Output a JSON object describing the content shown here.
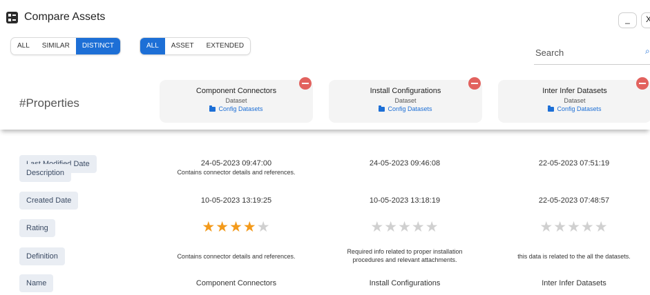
{
  "window": {
    "title": "Compare Assets",
    "minimize_label": "_",
    "close_label": "X"
  },
  "filters": {
    "similarity": [
      {
        "label": "All",
        "active": false
      },
      {
        "label": "Similar",
        "active": false
      },
      {
        "label": "Distinct",
        "active": true
      }
    ],
    "scope": [
      {
        "label": "All",
        "active": true
      },
      {
        "label": "Asset",
        "active": false
      },
      {
        "label": "Extended",
        "active": false
      }
    ]
  },
  "search": {
    "placeholder": "Search"
  },
  "header": {
    "properties_title": "#Properties"
  },
  "assets": [
    {
      "name": "Component Connectors",
      "type": "Dataset",
      "folder": "Config Datasets"
    },
    {
      "name": "Install Configurations",
      "type": "Dataset",
      "folder": "Config Datasets"
    },
    {
      "name": "Inter Infer Datasets",
      "type": "Dataset",
      "folder": "Config Datasets"
    }
  ],
  "rows": {
    "last_modified": {
      "label": "Last Modified Date",
      "values": [
        "24-05-2023 09:47:00",
        "24-05-2023 09:46:08",
        "22-05-2023 07:51:19"
      ]
    },
    "description": {
      "label": "Description",
      "values": [
        "Contains connector details and references.",
        "",
        ""
      ]
    },
    "created": {
      "label": "Created Date",
      "values": [
        "10-05-2023 13:19:25",
        "10-05-2023 13:18:19",
        "22-05-2023 07:48:57"
      ]
    },
    "rating": {
      "label": "Rating",
      "max": 5,
      "values": [
        4,
        0,
        0
      ]
    },
    "definition": {
      "label": "Definition",
      "values": [
        "Contains connector details and references.",
        "Required info related to proper installation procedures and relevant attachments.",
        "this data is related to the all the datasets."
      ]
    },
    "name": {
      "label": "Name",
      "values": [
        "Component Connectors",
        "Install Configurations",
        "Inter Infer Datasets"
      ]
    }
  },
  "colors": {
    "accent": "#1d6fd6",
    "remove": "#e2625e",
    "star_on": "#f39a1b",
    "star_off": "#d0d0d0",
    "label_bg": "#e9edf3"
  }
}
